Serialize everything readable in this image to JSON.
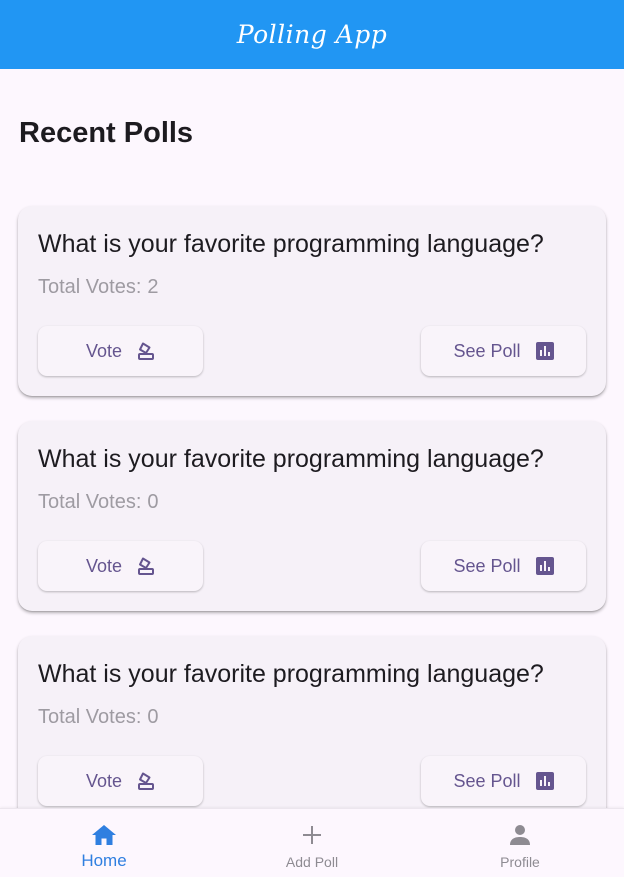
{
  "app_bar": {
    "title": "Polling App",
    "color": "#2196f3"
  },
  "section": {
    "title": "Recent Polls"
  },
  "polls": [
    {
      "question": "What is your favorite programming language?",
      "votes_label": "Total Votes:",
      "votes": "2",
      "vote_label": "Vote",
      "see_label": "See Poll"
    },
    {
      "question": "What is your favorite programming language?",
      "votes_label": "Total Votes:",
      "votes": "0",
      "vote_label": "Vote",
      "see_label": "See Poll"
    },
    {
      "question": "What is your favorite programming language?",
      "votes_label": "Total Votes:",
      "votes": "0",
      "vote_label": "Vote",
      "see_label": "See Poll"
    }
  ],
  "icons": {
    "vote": "ballot-box-icon",
    "see": "bar-chart-icon",
    "home": "home-icon",
    "add": "plus-icon",
    "profile": "person-icon"
  },
  "nav": {
    "selected": "home",
    "items": [
      {
        "id": "home",
        "label": "Home"
      },
      {
        "id": "add",
        "label": "Add Poll"
      },
      {
        "id": "profile",
        "label": "Profile"
      }
    ]
  },
  "colors": {
    "accent": "#65558f",
    "selected_nav": "#2f7fe0",
    "background": "#fdf7fe",
    "card": "#f6f1f8"
  }
}
